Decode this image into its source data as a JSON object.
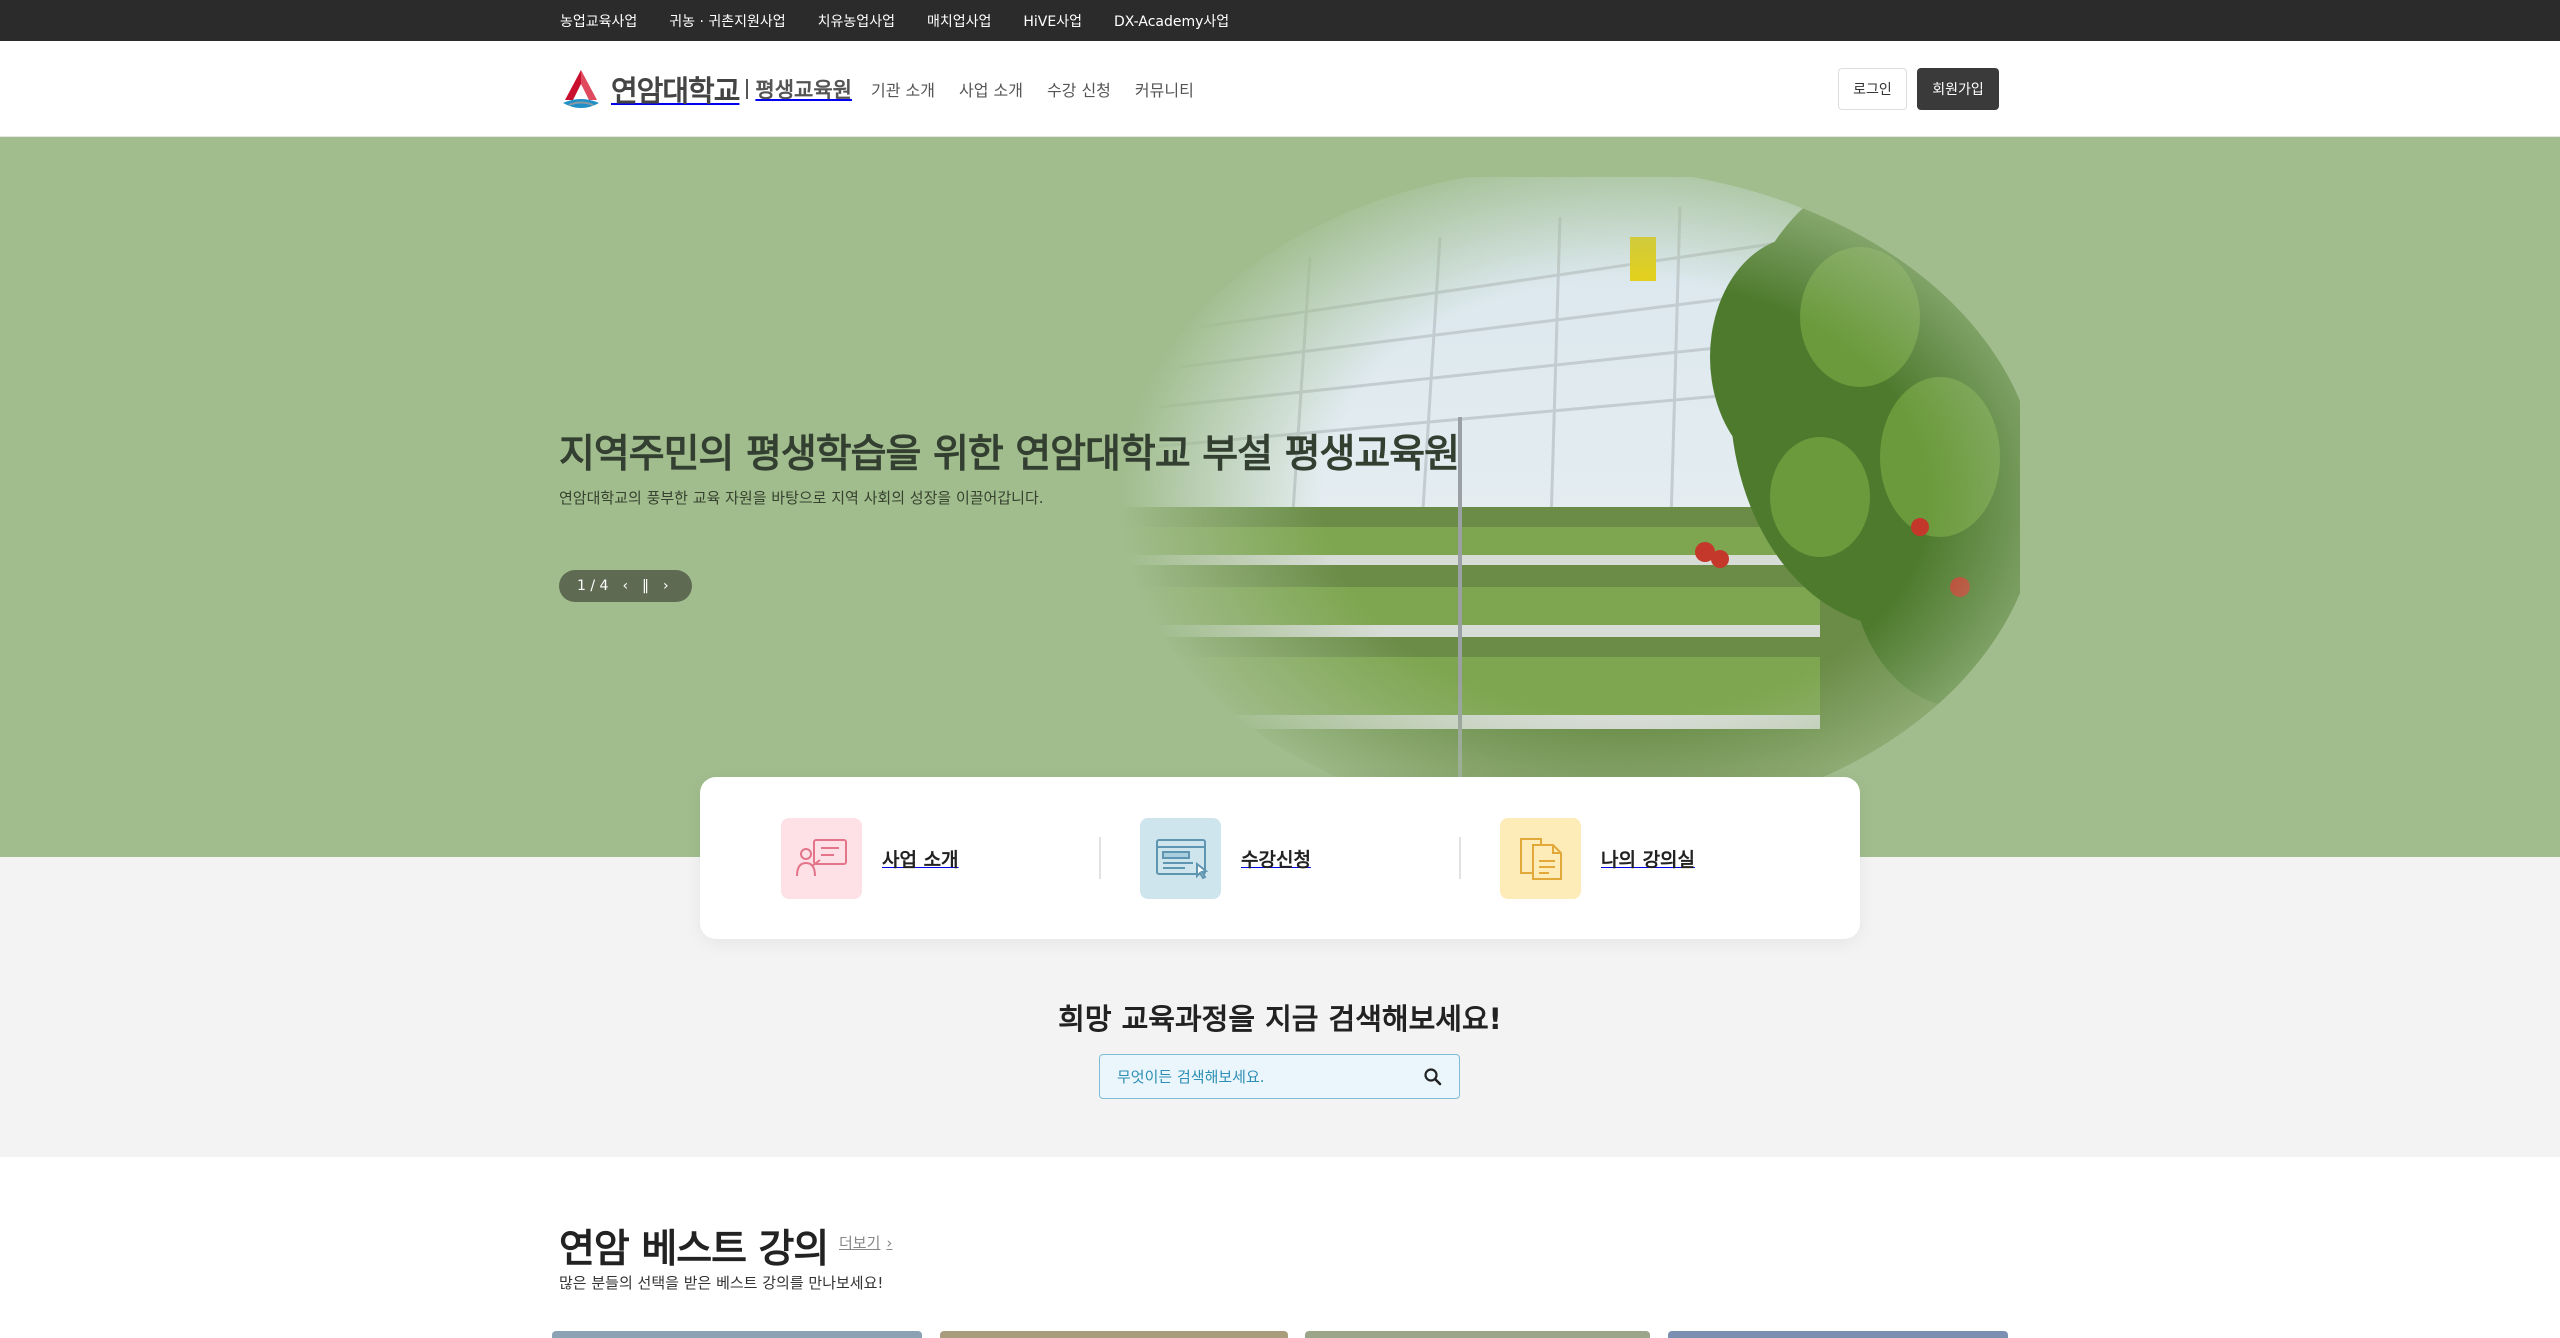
{
  "topbar": {
    "items": [
      "농업교육사업",
      "귀농 · 귀촌지원사업",
      "치유농업사업",
      "매치업사업",
      "HiVE사업",
      "DX-Academy사업"
    ]
  },
  "header": {
    "logo_name": "연암대학교",
    "logo_sub": "평생교육원",
    "nav": [
      "기관 소개",
      "사업 소개",
      "수강 신청",
      "커뮤니티"
    ],
    "login_label": "로그인",
    "join_label": "회원가입"
  },
  "hero": {
    "title": "지역주민의 평생학습을 위한 연암대학교 부설 평생교육원",
    "desc": "연암대학교의 풍부한 교육 자원을 바탕으로 지역 사회의 성장을 이끌어갑니다.",
    "slide_counter": "1 / 4",
    "current_slide": 1,
    "total_slides": 4,
    "bg_color": "#a1bd8d"
  },
  "quick": {
    "items": [
      {
        "label": "사업 소개",
        "icon": "presentation-icon",
        "bg": "#fde1e6"
      },
      {
        "label": "수강신청",
        "icon": "web-form-icon",
        "bg": "#cfe5ee"
      },
      {
        "label": "나의 강의실",
        "icon": "documents-icon",
        "bg": "#fdebb8"
      }
    ]
  },
  "search": {
    "title": "희망 교육과정을 지금 검색해보세요!",
    "placeholder": "무엇이든 검색해보세요."
  },
  "best": {
    "title": "연암 베스트 강의",
    "more_label": "더보기",
    "desc": "많은 분들의 선택을 받은 베스트 강의를 만나보세요!"
  },
  "colors": {
    "topbar": "#2b2b2b",
    "accent_dark": "#3a3a3a",
    "search_border": "#7fbcd3"
  }
}
